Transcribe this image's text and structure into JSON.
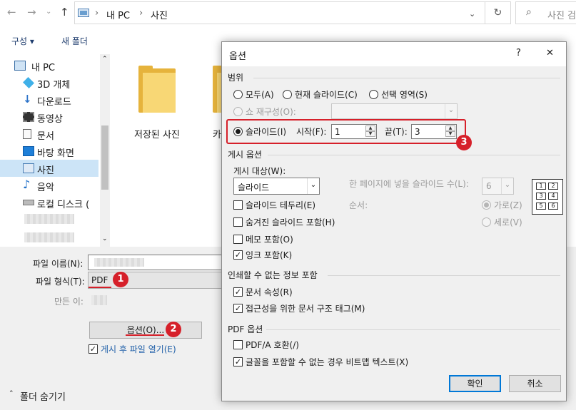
{
  "address_bar": {
    "path": [
      "내 PC",
      "사진"
    ],
    "search_placeholder": "사진 검"
  },
  "toolbar": {
    "organize_label": "구성 ▾",
    "new_folder_label": "새 폴더"
  },
  "sidebar": {
    "items": [
      {
        "label": "내 PC",
        "icon": "pc-icon"
      },
      {
        "label": "3D 개체",
        "icon": "cube-icon"
      },
      {
        "label": "다운로드",
        "icon": "download-icon"
      },
      {
        "label": "동영상",
        "icon": "video-icon"
      },
      {
        "label": "문서",
        "icon": "document-icon"
      },
      {
        "label": "바탕 화면",
        "icon": "desktop-icon"
      },
      {
        "label": "사진",
        "icon": "pictures-icon"
      },
      {
        "label": "음악",
        "icon": "music-icon"
      },
      {
        "label": "로컬 디스크 (",
        "icon": "disk-icon"
      }
    ]
  },
  "content": {
    "folders": [
      {
        "label": "저장된 사진"
      },
      {
        "label": "카"
      }
    ]
  },
  "save_panel": {
    "filename_label": "파일 이름(N):",
    "filetype_label": "파일 형식(T):",
    "filetype_value": "PDF",
    "author_label": "만든 이:",
    "options_button": "옵션(O)...",
    "open_after_publish": "게시 후 파일 열기(E)",
    "hide_folders": "폴더 숨기기",
    "badges": [
      "1",
      "2",
      "3"
    ]
  },
  "dialog": {
    "title": "옵션",
    "help": "?",
    "close": "✕",
    "range": {
      "label": "범위",
      "all": "모두(A)",
      "current_slide": "현재 슬라이드(C)",
      "selection": "선택 영역(S)",
      "custom_show": "쇼 재구성(O):",
      "slides": "슬라이드(I)",
      "from_label": "시작(F):",
      "from_value": "1",
      "to_label": "끝(T):",
      "to_value": "3"
    },
    "publish": {
      "label": "게시 옵션",
      "what_label": "게시 대상(W):",
      "what_value": "슬라이드",
      "per_page_label": "한 페이지에 넣을 슬라이드 수(L):",
      "per_page_value": "6",
      "order_label": "순서:",
      "horizontal": "가로(Z)",
      "vertical": "세로(V)",
      "frame_slides": "슬라이드 테두리(E)",
      "include_hidden": "숨겨진 슬라이드 포함(H)",
      "include_comments": "메모 포함(O)",
      "include_ink": "잉크 포함(K)",
      "layout_numbers": [
        "1",
        "2",
        "3",
        "4",
        "5",
        "6"
      ]
    },
    "non_printing": {
      "label": "인쇄할 수 없는 정보 포함",
      "doc_properties": "문서 속성(R)",
      "structure_tags": "접근성을 위한 문서 구조 태그(M)"
    },
    "pdf": {
      "label": "PDF 옵션",
      "pdfa": "PDF/A 호환(/)",
      "bitmap_text": "글꼴을 포함할 수 없는 경우 비트맵 텍스트(X)"
    },
    "ok": "확인",
    "cancel": "취소"
  }
}
